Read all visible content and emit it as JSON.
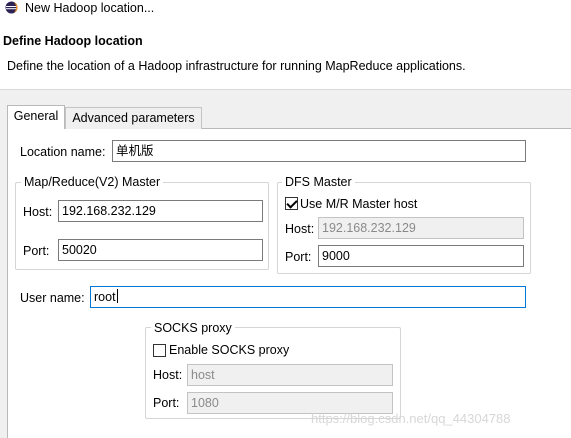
{
  "window": {
    "title": "New Hadoop location..."
  },
  "header": {
    "title": "Define Hadoop location",
    "description": "Define the location of a Hadoop infrastructure for running MapReduce applications."
  },
  "tabs": [
    {
      "label": "General",
      "selected": true
    },
    {
      "label": "Advanced parameters",
      "selected": false
    }
  ],
  "general": {
    "location_name": {
      "label": "Location name:",
      "value": "单机版"
    },
    "mapreduce_master": {
      "title": "Map/Reduce(V2) Master",
      "host": {
        "label": "Host:",
        "value": "192.168.232.129"
      },
      "port": {
        "label": "Port:",
        "value": "50020"
      }
    },
    "dfs_master": {
      "title": "DFS Master",
      "use_mr_host": {
        "label": "Use M/R Master host",
        "checked": true
      },
      "host": {
        "label": "Host:",
        "value": "192.168.232.129"
      },
      "port": {
        "label": "Port:",
        "value": "9000"
      }
    },
    "user_name": {
      "label": "User name:",
      "value": "root"
    },
    "socks_proxy": {
      "title": "SOCKS proxy",
      "enable": {
        "label": "Enable SOCKS proxy",
        "checked": false
      },
      "host": {
        "label": "Host:",
        "value": "host"
      },
      "port": {
        "label": "Port:",
        "value": "1080"
      }
    }
  },
  "watermark": "https://blog.csdn.net/qq_44304788"
}
